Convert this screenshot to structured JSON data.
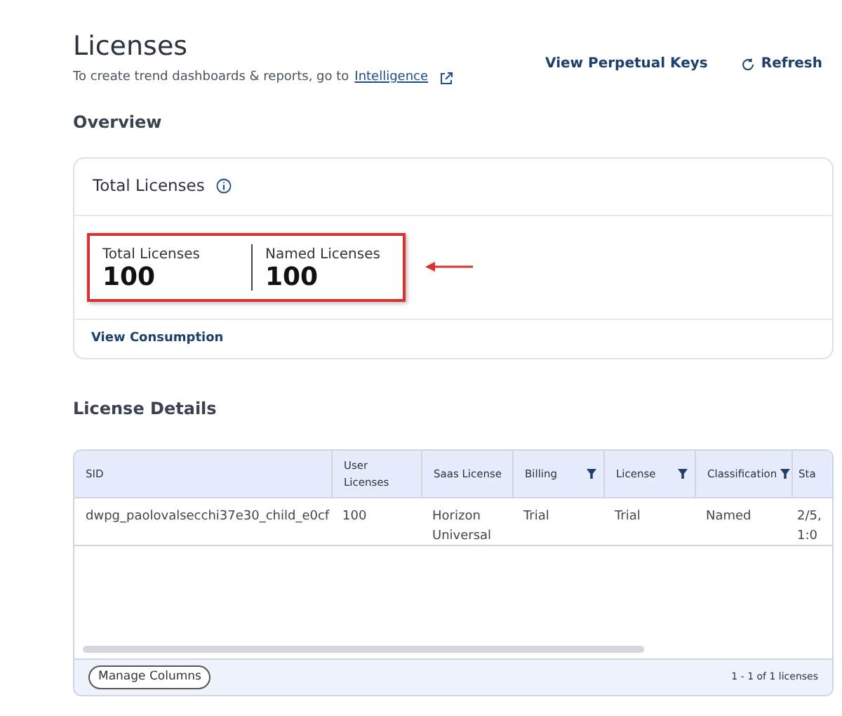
{
  "header": {
    "title": "Licenses",
    "subtitle": "To create trend dashboards & reports, go to",
    "link": "Intelligence",
    "actions": [
      "View Perpetual Keys",
      "Refresh"
    ]
  },
  "overview": {
    "heading": "Overview",
    "card_title": "Total Licenses",
    "stats": [
      {
        "label": "Total Licenses",
        "value": "100"
      },
      {
        "label": "Named Licenses",
        "value": "100"
      }
    ],
    "footer_link": "View Consumption"
  },
  "details": {
    "heading": "License Details",
    "columns": [
      {
        "label": "SID",
        "filter": false
      },
      {
        "label": "User Licenses",
        "filter": false
      },
      {
        "label": "Saas License",
        "filter": false
      },
      {
        "label": "Billing",
        "filter": true
      },
      {
        "label": "License",
        "filter": true
      },
      {
        "label": "Classification",
        "filter": true
      },
      {
        "label": "Sta"
      }
    ],
    "rows": [
      [
        "dwpg_paolovalsecchi37e30_child_e0cf",
        "100",
        "Horizon Universal",
        "Trial",
        "Trial",
        "Named",
        "2/5, 1:0"
      ]
    ],
    "manage_button": "Manage Columns",
    "pagination": "1 - 1 of 1 licenses"
  }
}
